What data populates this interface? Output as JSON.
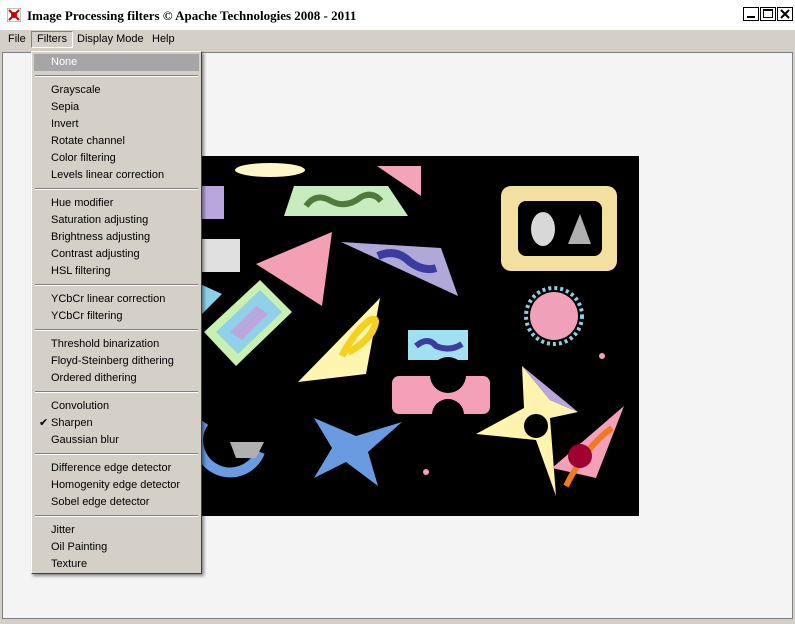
{
  "window": {
    "title": "Image Processing filters © Apache Technologies 2008 - 2011",
    "icon": "app-logo-icon",
    "controls": [
      "minimize-icon",
      "maximize-icon",
      "close-icon"
    ]
  },
  "menubar": {
    "items": [
      "File",
      "Filters",
      "Display Mode",
      "Help"
    ],
    "open_item": "Filters"
  },
  "filters_menu": {
    "groups": [
      [
        "None"
      ],
      [
        "Grayscale",
        "Sepia",
        "Invert",
        "Rotate channel",
        "Color filtering",
        "Levels linear correction"
      ],
      [
        "Hue modifier",
        "Saturation adjusting",
        "Brightness adjusting",
        "Contrast adjusting",
        "HSL filtering"
      ],
      [
        "YCbCr linear correction",
        "YCbCr filtering"
      ],
      [
        "Threshold binarization",
        "Floyd-Steinberg dithering",
        "Ordered dithering"
      ],
      [
        "Convolution",
        "Sharpen",
        "Gaussian blur"
      ],
      [
        "Difference edge detector",
        "Homogenity edge detector",
        "Sobel edge detector"
      ],
      [
        "Jitter",
        "Oil Painting",
        "Texture"
      ]
    ],
    "highlighted": "None",
    "checked": "Sharpen"
  },
  "colors": {
    "canvas_background": "#000000",
    "menu_highlight": "#a6a6a6",
    "client_background": "#f4f4f4"
  }
}
